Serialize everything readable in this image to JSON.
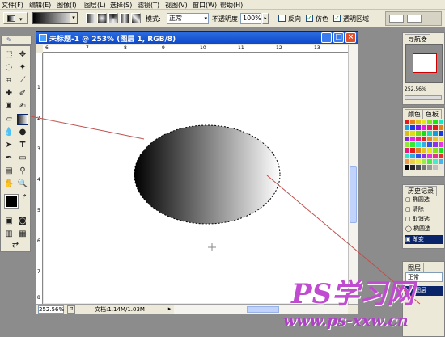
{
  "menubar": {
    "items": [
      "文件(F)",
      "编辑(E)",
      "图像(I)",
      "图层(L)",
      "选择(S)",
      "滤镜(T)",
      "视图(V)",
      "窗口(W)",
      "帮助(H)"
    ]
  },
  "options": {
    "mode_label": "模式:",
    "mode_value": "正常",
    "opacity_label": "不透明度:",
    "opacity_value": "100%",
    "reverse_label": "反向",
    "dither_label": "仿色",
    "transparency_label": "透明区域",
    "reverse_checked": false,
    "dither_checked": true,
    "transparency_checked": true
  },
  "document": {
    "title": "未标题-1 @ 253% (图层 1, RGB/8)",
    "ruler_top": [
      "6",
      "7",
      "8",
      "9",
      "10",
      "11",
      "12",
      "13"
    ],
    "ruler_left": [
      "1",
      "2",
      "3",
      "4",
      "5",
      "6",
      "7",
      "8"
    ],
    "status_zoom": "252.56%",
    "status_doc": "文档:1.14M/1.03M"
  },
  "panels": {
    "navigator_tab": "导航器",
    "navigator_zoom": "252.56%",
    "color_tab": "颜色",
    "swatches_tab": "色板",
    "history_tab": "历史记录",
    "history_items": [
      "椭圆选",
      "清除",
      "取消选",
      "椭圆选",
      "渐变"
    ],
    "layers_tab": "图层",
    "layers_mode": "正常",
    "layers_item": "图层"
  },
  "watermark": {
    "line1": "PS学习网",
    "line2": "www.ps-xxw.cn"
  },
  "colors": {
    "titlebar": "#0a46c8",
    "guide_line": "#c0504d",
    "watermark": "#c04ad0"
  }
}
